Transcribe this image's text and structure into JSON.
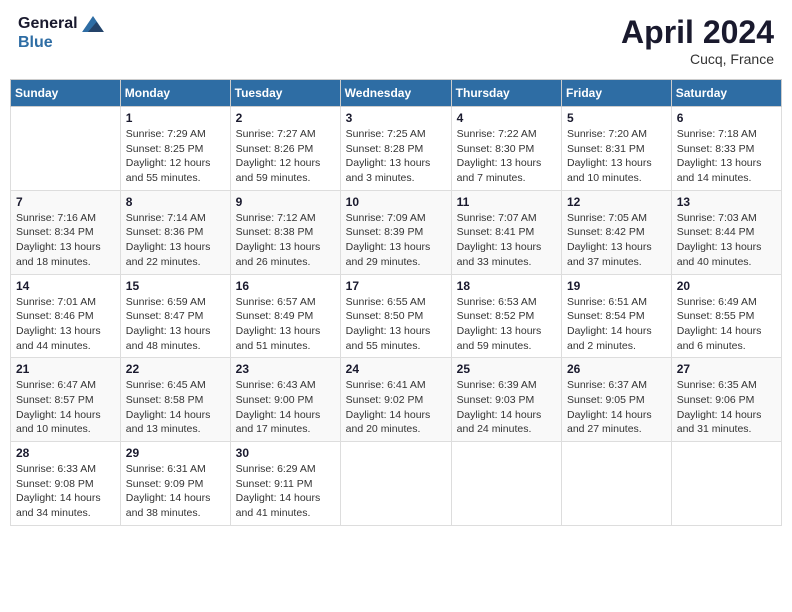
{
  "header": {
    "logo_line1": "General",
    "logo_line2": "Blue",
    "month_year": "April 2024",
    "location": "Cucq, France"
  },
  "weekdays": [
    "Sunday",
    "Monday",
    "Tuesday",
    "Wednesday",
    "Thursday",
    "Friday",
    "Saturday"
  ],
  "weeks": [
    [
      {
        "day": "",
        "info": ""
      },
      {
        "day": "1",
        "info": "Sunrise: 7:29 AM\nSunset: 8:25 PM\nDaylight: 12 hours\nand 55 minutes."
      },
      {
        "day": "2",
        "info": "Sunrise: 7:27 AM\nSunset: 8:26 PM\nDaylight: 12 hours\nand 59 minutes."
      },
      {
        "day": "3",
        "info": "Sunrise: 7:25 AM\nSunset: 8:28 PM\nDaylight: 13 hours\nand 3 minutes."
      },
      {
        "day": "4",
        "info": "Sunrise: 7:22 AM\nSunset: 8:30 PM\nDaylight: 13 hours\nand 7 minutes."
      },
      {
        "day": "5",
        "info": "Sunrise: 7:20 AM\nSunset: 8:31 PM\nDaylight: 13 hours\nand 10 minutes."
      },
      {
        "day": "6",
        "info": "Sunrise: 7:18 AM\nSunset: 8:33 PM\nDaylight: 13 hours\nand 14 minutes."
      }
    ],
    [
      {
        "day": "7",
        "info": "Sunrise: 7:16 AM\nSunset: 8:34 PM\nDaylight: 13 hours\nand 18 minutes."
      },
      {
        "day": "8",
        "info": "Sunrise: 7:14 AM\nSunset: 8:36 PM\nDaylight: 13 hours\nand 22 minutes."
      },
      {
        "day": "9",
        "info": "Sunrise: 7:12 AM\nSunset: 8:38 PM\nDaylight: 13 hours\nand 26 minutes."
      },
      {
        "day": "10",
        "info": "Sunrise: 7:09 AM\nSunset: 8:39 PM\nDaylight: 13 hours\nand 29 minutes."
      },
      {
        "day": "11",
        "info": "Sunrise: 7:07 AM\nSunset: 8:41 PM\nDaylight: 13 hours\nand 33 minutes."
      },
      {
        "day": "12",
        "info": "Sunrise: 7:05 AM\nSunset: 8:42 PM\nDaylight: 13 hours\nand 37 minutes."
      },
      {
        "day": "13",
        "info": "Sunrise: 7:03 AM\nSunset: 8:44 PM\nDaylight: 13 hours\nand 40 minutes."
      }
    ],
    [
      {
        "day": "14",
        "info": "Sunrise: 7:01 AM\nSunset: 8:46 PM\nDaylight: 13 hours\nand 44 minutes."
      },
      {
        "day": "15",
        "info": "Sunrise: 6:59 AM\nSunset: 8:47 PM\nDaylight: 13 hours\nand 48 minutes."
      },
      {
        "day": "16",
        "info": "Sunrise: 6:57 AM\nSunset: 8:49 PM\nDaylight: 13 hours\nand 51 minutes."
      },
      {
        "day": "17",
        "info": "Sunrise: 6:55 AM\nSunset: 8:50 PM\nDaylight: 13 hours\nand 55 minutes."
      },
      {
        "day": "18",
        "info": "Sunrise: 6:53 AM\nSunset: 8:52 PM\nDaylight: 13 hours\nand 59 minutes."
      },
      {
        "day": "19",
        "info": "Sunrise: 6:51 AM\nSunset: 8:54 PM\nDaylight: 14 hours\nand 2 minutes."
      },
      {
        "day": "20",
        "info": "Sunrise: 6:49 AM\nSunset: 8:55 PM\nDaylight: 14 hours\nand 6 minutes."
      }
    ],
    [
      {
        "day": "21",
        "info": "Sunrise: 6:47 AM\nSunset: 8:57 PM\nDaylight: 14 hours\nand 10 minutes."
      },
      {
        "day": "22",
        "info": "Sunrise: 6:45 AM\nSunset: 8:58 PM\nDaylight: 14 hours\nand 13 minutes."
      },
      {
        "day": "23",
        "info": "Sunrise: 6:43 AM\nSunset: 9:00 PM\nDaylight: 14 hours\nand 17 minutes."
      },
      {
        "day": "24",
        "info": "Sunrise: 6:41 AM\nSunset: 9:02 PM\nDaylight: 14 hours\nand 20 minutes."
      },
      {
        "day": "25",
        "info": "Sunrise: 6:39 AM\nSunset: 9:03 PM\nDaylight: 14 hours\nand 24 minutes."
      },
      {
        "day": "26",
        "info": "Sunrise: 6:37 AM\nSunset: 9:05 PM\nDaylight: 14 hours\nand 27 minutes."
      },
      {
        "day": "27",
        "info": "Sunrise: 6:35 AM\nSunset: 9:06 PM\nDaylight: 14 hours\nand 31 minutes."
      }
    ],
    [
      {
        "day": "28",
        "info": "Sunrise: 6:33 AM\nSunset: 9:08 PM\nDaylight: 14 hours\nand 34 minutes."
      },
      {
        "day": "29",
        "info": "Sunrise: 6:31 AM\nSunset: 9:09 PM\nDaylight: 14 hours\nand 38 minutes."
      },
      {
        "day": "30",
        "info": "Sunrise: 6:29 AM\nSunset: 9:11 PM\nDaylight: 14 hours\nand 41 minutes."
      },
      {
        "day": "",
        "info": ""
      },
      {
        "day": "",
        "info": ""
      },
      {
        "day": "",
        "info": ""
      },
      {
        "day": "",
        "info": ""
      }
    ]
  ]
}
